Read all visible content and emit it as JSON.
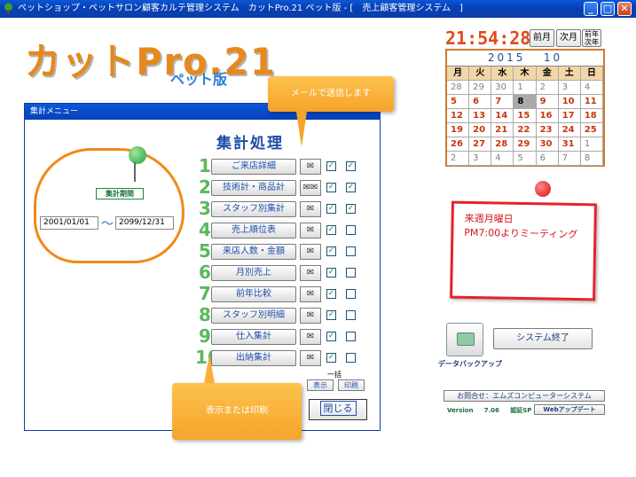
{
  "window": {
    "title": "ペットショップ・ペットサロン顧客カルテ管理システム　カットPro.21 ペット版 - [　売上顧客管理システム　]",
    "minimize": "_",
    "maximize": "□",
    "close": "✕"
  },
  "logo": {
    "main": "カットPro.21",
    "sub": "ペット版"
  },
  "clock": {
    "time": "21:54:28",
    "prev_month": "前月",
    "next_month": "次月",
    "prev_year": "前年",
    "next_year": "次年"
  },
  "calendar": {
    "year": "2015",
    "month": "10",
    "weekdays": [
      "月",
      "火",
      "水",
      "木",
      "金",
      "土",
      "日"
    ],
    "weeks": [
      [
        {
          "d": "28",
          "t": "oth"
        },
        {
          "d": "29",
          "t": "oth"
        },
        {
          "d": "30",
          "t": "oth"
        },
        {
          "d": "1",
          "t": "oth"
        },
        {
          "d": "2",
          "t": "oth"
        },
        {
          "d": "3",
          "t": "oth"
        },
        {
          "d": "4",
          "t": "oth"
        }
      ],
      [
        {
          "d": "5",
          "t": "cur"
        },
        {
          "d": "6",
          "t": "cur"
        },
        {
          "d": "7",
          "t": "cur"
        },
        {
          "d": "8",
          "t": "today"
        },
        {
          "d": "9",
          "t": "cur"
        },
        {
          "d": "10",
          "t": "cur"
        },
        {
          "d": "11",
          "t": "cur"
        }
      ],
      [
        {
          "d": "12",
          "t": "cur"
        },
        {
          "d": "13",
          "t": "cur"
        },
        {
          "d": "14",
          "t": "cur"
        },
        {
          "d": "15",
          "t": "cur"
        },
        {
          "d": "16",
          "t": "cur"
        },
        {
          "d": "17",
          "t": "cur"
        },
        {
          "d": "18",
          "t": "cur"
        }
      ],
      [
        {
          "d": "19",
          "t": "cur"
        },
        {
          "d": "20",
          "t": "cur"
        },
        {
          "d": "21",
          "t": "cur"
        },
        {
          "d": "22",
          "t": "cur"
        },
        {
          "d": "23",
          "t": "cur"
        },
        {
          "d": "24",
          "t": "cur"
        },
        {
          "d": "25",
          "t": "cur"
        }
      ],
      [
        {
          "d": "26",
          "t": "cur"
        },
        {
          "d": "27",
          "t": "cur"
        },
        {
          "d": "28",
          "t": "cur"
        },
        {
          "d": "29",
          "t": "cur"
        },
        {
          "d": "30",
          "t": "cur"
        },
        {
          "d": "31",
          "t": "cur"
        },
        {
          "d": "1",
          "t": "oth"
        }
      ],
      [
        {
          "d": "2",
          "t": "oth"
        },
        {
          "d": "3",
          "t": "oth"
        },
        {
          "d": "4",
          "t": "oth"
        },
        {
          "d": "5",
          "t": "oth"
        },
        {
          "d": "6",
          "t": "oth"
        },
        {
          "d": "7",
          "t": "oth"
        },
        {
          "d": "8",
          "t": "oth"
        }
      ]
    ]
  },
  "memo": {
    "line1": "来週月曜日",
    "line2": "PM7:00よりミーティング"
  },
  "backup_label": "データバックアップ",
  "exit_label": "システム終了",
  "contact_label": "お問合せ：エムズコンピューターシステム",
  "version_label": "Version",
  "version": "7.06",
  "certified": "認証SP",
  "web_update": "Webアップデート",
  "dialog": {
    "title": "集計メニュー",
    "heading": "集計処理",
    "period_label": "集計期間",
    "date_from": "2001/01/01",
    "tilde": "～",
    "date_to": "2099/12/31",
    "rows": [
      {
        "num": "1",
        "label": "ご来店詳細",
        "mail": "✉",
        "c1": true,
        "c2": true
      },
      {
        "num": "2",
        "label": "技術計・商品計",
        "mail": "✉✉",
        "c1": true,
        "c2": true
      },
      {
        "num": "3",
        "label": "スタッフ別集計",
        "mail": "✉",
        "c1": true,
        "c2": true
      },
      {
        "num": "4",
        "label": "売上順位表",
        "mail": "✉",
        "c1": true,
        "c2": false
      },
      {
        "num": "5",
        "label": "来店人数・金額",
        "mail": "✉",
        "c1": true,
        "c2": false
      },
      {
        "num": "6",
        "label": "月別売上",
        "mail": "✉",
        "c1": true,
        "c2": false
      },
      {
        "num": "7",
        "label": "前年比較",
        "mail": "✉",
        "c1": true,
        "c2": false
      },
      {
        "num": "8",
        "label": "スタッフ別明細",
        "mail": "✉",
        "c1": true,
        "c2": false
      },
      {
        "num": "9",
        "label": "仕入集計",
        "mail": "✉",
        "c1": true,
        "c2": false
      },
      {
        "num": "10",
        "label": "出納集計",
        "mail": "✉",
        "c1": true,
        "c2": false
      }
    ],
    "batch_label": "一括",
    "show_btn": "表示",
    "print_btn": "印刷",
    "close_btn": "閉じる"
  },
  "callouts": {
    "mail": "メールで送信します",
    "print": "表示または印刷"
  }
}
